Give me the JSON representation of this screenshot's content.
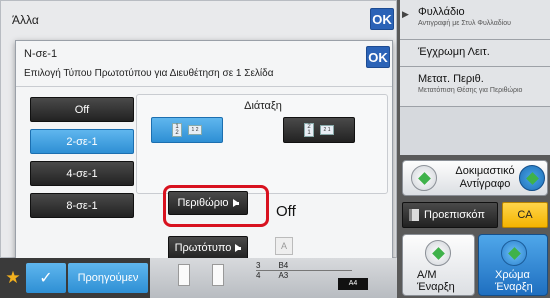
{
  "back_panel": {
    "title": "Άλλα",
    "ok_label": "OK"
  },
  "dialog": {
    "title": "N-σε-1",
    "subtitle": "Επιλογή Τύπου Πρωτοτύπου για Διευθέτηση σε 1 Σελίδα",
    "ok_label": "OK",
    "n_options": [
      {
        "label": "Off",
        "selected": false
      },
      {
        "label": "2-σε-1",
        "selected": true
      },
      {
        "label": "4-σε-1",
        "selected": false
      },
      {
        "label": "8-σε-1",
        "selected": false
      }
    ],
    "layout_label": "Διάταξη",
    "layout_opt1_pages": [
      "1",
      "2",
      "1",
      "2"
    ],
    "layout_opt2_pages": [
      "2",
      "1",
      "2",
      "1"
    ],
    "border_button": "Περιθώριο",
    "border_value": "Off",
    "original_button": "Πρωτότυπο",
    "a_chip": "A"
  },
  "right_panel": {
    "items": [
      {
        "title": "Φυλλάδιο",
        "sub": "Αντιγραφή με Στυλ Φυλλαδίου"
      },
      {
        "title": "Έγχρωμη Λειτ.",
        "sub": ""
      },
      {
        "title": "Μετατ. Περιθ.",
        "sub": "Μετατόπιση Θέσης για Περιθώριο"
      }
    ],
    "trial_copy": [
      "Δοκιμαστικό",
      "Αντίγραφο"
    ],
    "preview": "Προεπισκόπ",
    "ca": "CA",
    "start_bw": [
      "A/M",
      "Έναρξη"
    ],
    "start_color": [
      "Χρώμα",
      "Έναρξη"
    ]
  },
  "bottom": {
    "prev_label": "Προηγούμεν",
    "trays": [
      {
        "num": "3",
        "size": "B4"
      },
      {
        "num": "4",
        "size": "A3"
      }
    ],
    "tray_extra": "A4"
  },
  "colors": {
    "accent_blue": "#2e8fd4",
    "highlight_red": "#d8121f",
    "ca_yellow": "#f5b400",
    "star": "#f2b01e",
    "status_green": "#3fb24a"
  }
}
